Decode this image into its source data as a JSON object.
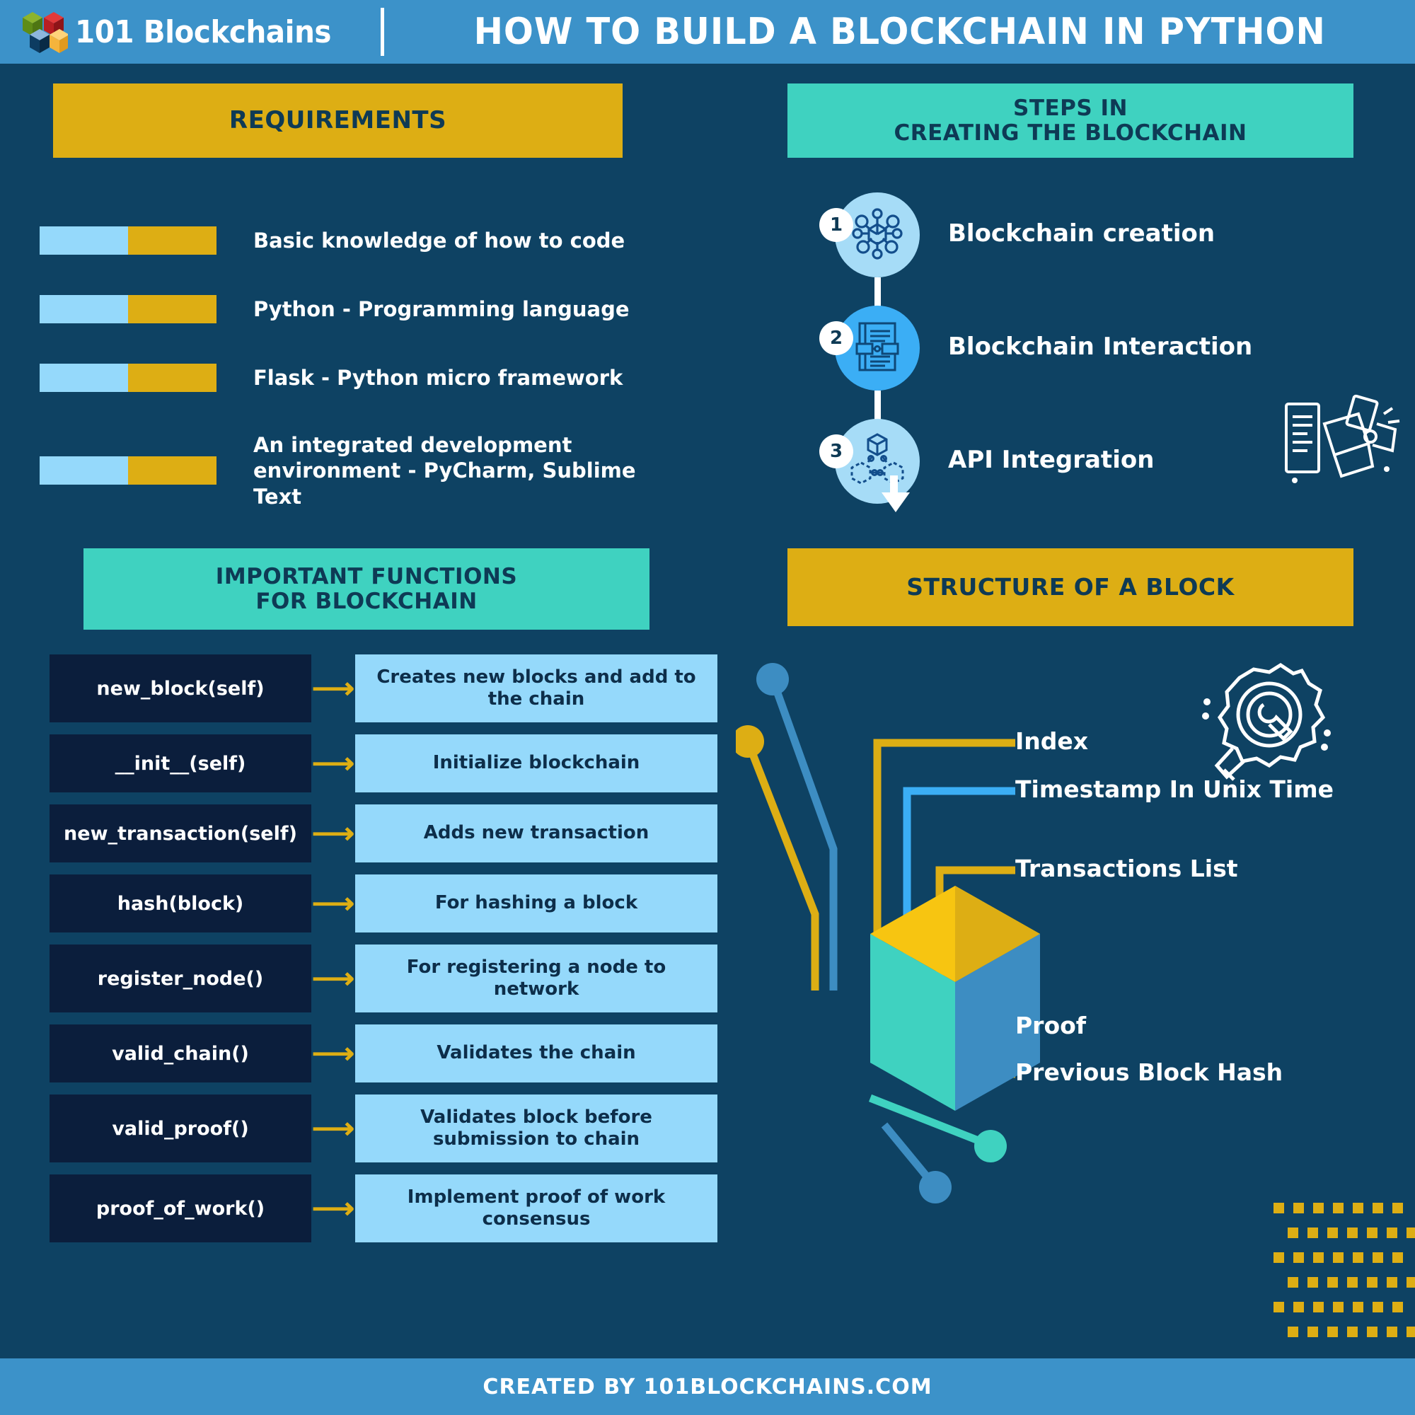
{
  "header": {
    "brand": "101 Blockchains",
    "title": "HOW TO BUILD A BLOCKCHAIN IN PYTHON",
    "logo_colors": [
      "#6D9B1E",
      "#C7242C",
      "#0D3C61",
      "#F4B43C"
    ]
  },
  "requirements": {
    "banner": "REQUIREMENTS",
    "bar_light_color": "#95D9FB",
    "bar_gold_color": "#DDAE14",
    "items": [
      {
        "label": "Basic knowledge of how to code"
      },
      {
        "label": "Python - Programming language"
      },
      {
        "label": "Flask - Python micro framework"
      },
      {
        "label": "An integrated development environment - PyCharm, Sublime Text"
      }
    ]
  },
  "steps": {
    "banner_line1": "STEPS IN",
    "banner_line2": "CREATING THE BLOCKCHAIN",
    "items": [
      {
        "number": "1",
        "label": "Blockchain creation",
        "icon": "network-cube-icon",
        "circle": "light"
      },
      {
        "number": "2",
        "label": "Blockchain Interaction",
        "icon": "document-blocks-icon",
        "circle": "bright"
      },
      {
        "number": "3",
        "label": "API Integration",
        "icon": "chain-cubes-icon",
        "circle": "light"
      }
    ]
  },
  "functions": {
    "banner_line1": "IMPORTANT FUNCTIONS",
    "banner_line2": "FOR BLOCKCHAIN",
    "rows": [
      {
        "name": "new_block(self)",
        "desc": "Creates new blocks and add to the chain"
      },
      {
        "name": "__init__(self)",
        "desc": "Initialize blockchain"
      },
      {
        "name": "new_transaction(self)",
        "desc": "Adds new transaction"
      },
      {
        "name": "hash(block)",
        "desc": "For hashing a block"
      },
      {
        "name": "register_node()",
        "desc": "For registering a node to network"
      },
      {
        "name": "valid_chain()",
        "desc": "Validates the chain"
      },
      {
        "name": "valid_proof()",
        "desc": "Validates block before submission to chain"
      },
      {
        "name": "proof_of_work()",
        "desc": "Implement proof of work consensus"
      }
    ]
  },
  "structure": {
    "banner": "STRUCTURE OF A BLOCK",
    "labels": [
      {
        "text": "Index",
        "color": "#DDAE14"
      },
      {
        "text": "Timestamp In Unix Time",
        "color": "#3BAEF5"
      },
      {
        "text": "Transactions List",
        "color": "#DDAE14"
      },
      {
        "text": "Proof",
        "color": "#3D8DC2"
      },
      {
        "text": "Previous Block Hash",
        "color": "#DDAE14"
      }
    ],
    "cube_colors": {
      "top_light": "#F7C511",
      "top_dark": "#DDAE14",
      "left_face": "#3FD2C0",
      "right_face": "#3D8DC2"
    }
  },
  "footer": {
    "text": "CREATED BY 101BLOCKCHAINS.COM"
  },
  "palette": {
    "background": "#0E4263",
    "header_bar": "#3C92C9",
    "gold": "#DDAE14",
    "teal": "#3FD2C0",
    "light_blue": "#95D9FB",
    "bright_blue": "#3BAEF5",
    "navy_box": "#0B1E3C"
  }
}
